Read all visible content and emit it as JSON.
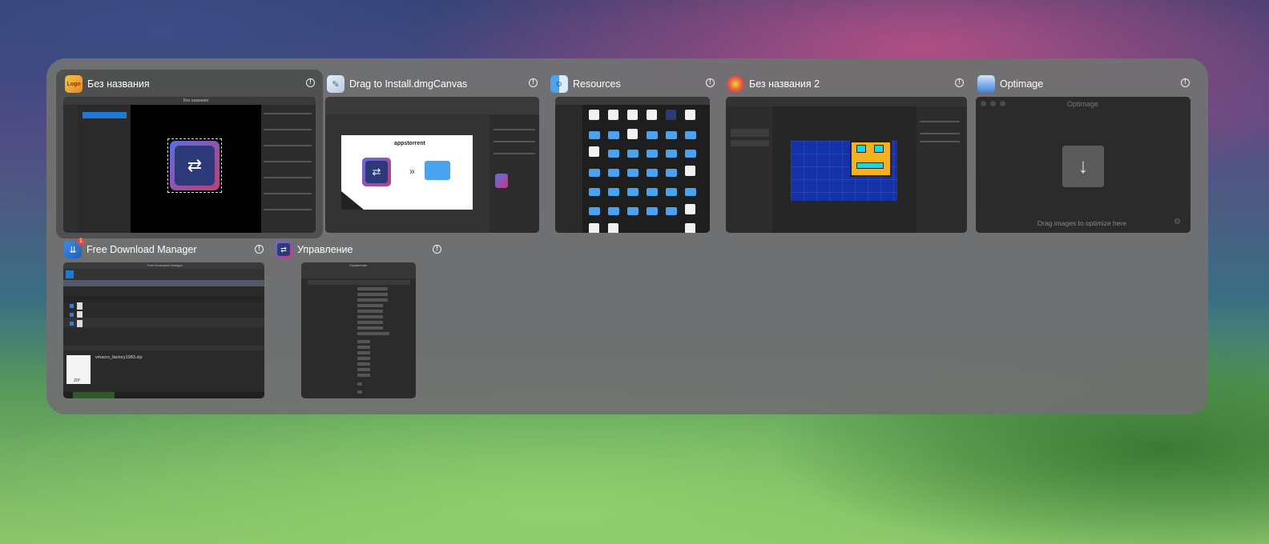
{
  "windows": [
    {
      "title": "Без названия",
      "icon": "logoist-app-icon",
      "selected": true
    },
    {
      "title": "Drag to Install.dmgCanvas",
      "icon": "dmgcanvas-app-icon"
    },
    {
      "title": "Resources",
      "icon": "finder-app-icon"
    },
    {
      "title": "Без названия 2",
      "icon": "pixelmator-app-icon"
    },
    {
      "title": "Optimage",
      "icon": "optimage-app-icon"
    },
    {
      "title": "Free Download Manager",
      "icon": "fdm-app-icon",
      "badge": "1"
    },
    {
      "title": "Управление",
      "icon": "settings-app-icon"
    }
  ],
  "thumb_texts": {
    "logoist_title": "Без названия",
    "dmg_brand": "appstorrent",
    "optimage_title": "Optimage",
    "optimage_hint": "Drag images to optimize here",
    "fdm_title": "Free Download Manager",
    "fdm_file": "vmacro_factory1983.zip",
    "fdm_zip": "ZIP",
    "mgmt_title": "Управление"
  },
  "colors": {
    "accent": "#1e7ad6",
    "folder": "#4aa3ef",
    "gd_blue": "#1432a8",
    "gd_yellow": "#f5b21f"
  }
}
